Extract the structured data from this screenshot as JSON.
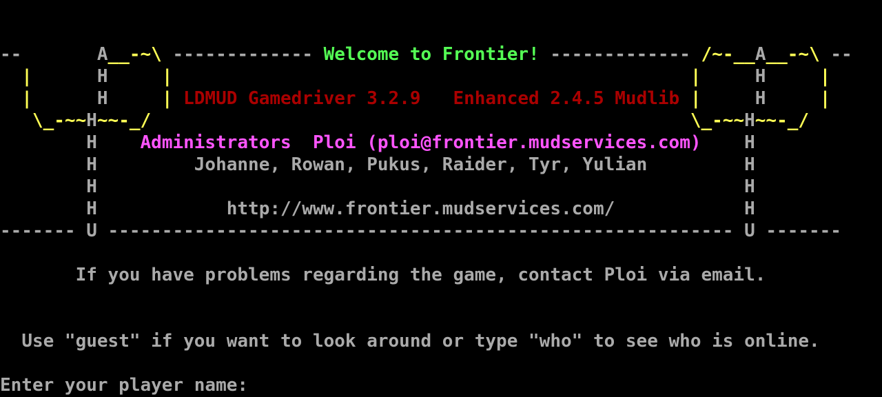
{
  "banner": {
    "welcome": "Welcome to Frontier!",
    "driver": "LDMUD Gamedriver 3.2.9",
    "mudlib": "Enhanced 2.4.5 Mudlib",
    "administrators_label": "Administrators",
    "admin_contact": "Ploi (ploi@frontier.mudservices.com)",
    "staff": "Johanne, Rowan, Pukus, Raider, Tyr, Yulian",
    "url": "http://www.frontier.mudservices.com/"
  },
  "notice_problems": "If you have problems regarding the game, contact Ploi via email.",
  "notice_guest": "Use \"guest\" if you want to look around or type \"who\" to see who is online.",
  "prompt": "Enter your player name:",
  "colors": {
    "background": "#000000",
    "default_text": "#aaaaaa",
    "anchor_art": "#ffff55",
    "welcome": "#55ff55",
    "driver_info": "#aa0000",
    "administrators": "#ff55ff"
  }
}
